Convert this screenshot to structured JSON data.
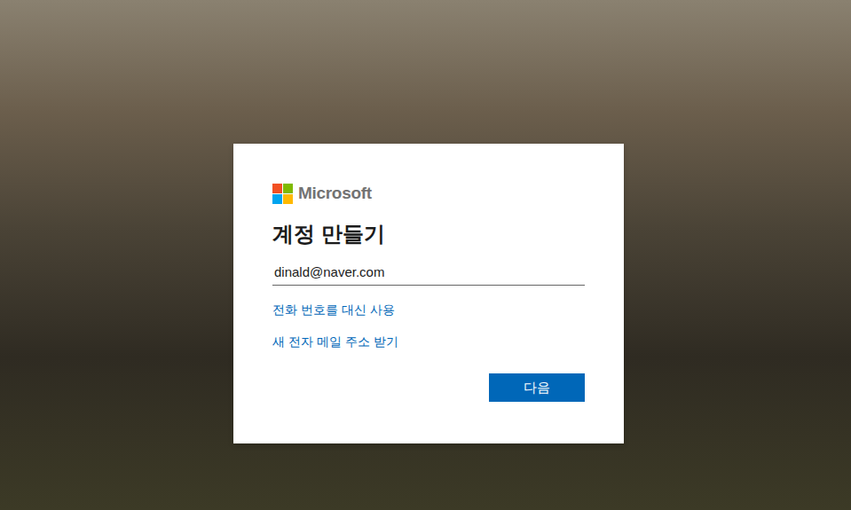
{
  "window": {
    "title": "계정 만들기"
  },
  "brand": {
    "name": "Microsoft"
  },
  "email_field": {
    "value": "dinald@naver.com"
  },
  "links": [
    "전화 번호를 대신 사용",
    "새 전자 메일 주소 받기"
  ],
  "buttons": [
    {
      "label": "다음",
      "primary": true
    }
  ]
}
